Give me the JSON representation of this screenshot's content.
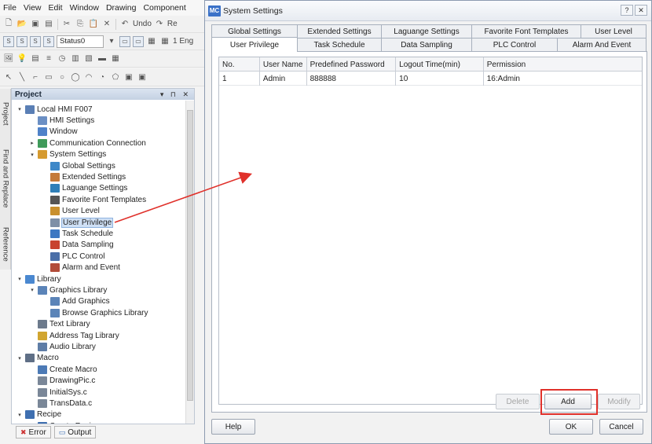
{
  "ide": {
    "menu": [
      "File",
      "View",
      "Edit",
      "Window",
      "Drawing",
      "Component"
    ],
    "toolbar1": {
      "undo_label": "Undo",
      "redo_label": "Re"
    },
    "toolbar2": {
      "status_combo": "Status0",
      "lang_label": "1 Eng"
    },
    "sidetabs": [
      "Project",
      "Find and Replace",
      "Reference"
    ],
    "project": {
      "title": "Project",
      "controls": "▾ ⊓ ✕",
      "tree": [
        {
          "label": "Local HMI F007",
          "level": 0,
          "exp": "▾",
          "icon": "monitor-icon",
          "color": "#5a7fb5"
        },
        {
          "label": "HMI Settings",
          "level": 1,
          "exp": "",
          "icon": "settings-icon",
          "color": "#6b8fc4"
        },
        {
          "label": "Window",
          "level": 1,
          "exp": "",
          "icon": "window-icon",
          "color": "#4f82c9"
        },
        {
          "label": "Communication Connection",
          "level": 1,
          "exp": "▸",
          "icon": "connection-icon",
          "color": "#3f9a5a"
        },
        {
          "label": "System Settings",
          "level": 1,
          "exp": "▾",
          "icon": "gear-icon",
          "color": "#d59a30"
        },
        {
          "label": "Global Settings",
          "level": 2,
          "exp": "",
          "icon": "globe-icon",
          "color": "#3e88c8"
        },
        {
          "label": "Extended Settings",
          "level": 2,
          "exp": "",
          "icon": "extend-icon",
          "color": "#c47a3a"
        },
        {
          "label": "Laguange Settings",
          "level": 2,
          "exp": "",
          "icon": "language-icon",
          "color": "#2f7fb8"
        },
        {
          "label": "Favorite Font Templates",
          "level": 2,
          "exp": "",
          "icon": "font-icon",
          "color": "#555555"
        },
        {
          "label": "User Level",
          "level": 2,
          "exp": "",
          "icon": "user-level-icon",
          "color": "#c9902e"
        },
        {
          "label": "User Privilege",
          "level": 2,
          "exp": "",
          "icon": "user-privilege-icon",
          "color": "#7e8fa6",
          "selected": true
        },
        {
          "label": "Task Schedule",
          "level": 2,
          "exp": "",
          "icon": "schedule-icon",
          "color": "#3d78c2"
        },
        {
          "label": "Data Sampling",
          "level": 2,
          "exp": "",
          "icon": "chart-icon",
          "color": "#c8432f"
        },
        {
          "label": "PLC Control",
          "level": 2,
          "exp": "",
          "icon": "plc-icon",
          "color": "#4a6fa8"
        },
        {
          "label": "Alarm and Event",
          "level": 2,
          "exp": "",
          "icon": "alarm-icon",
          "color": "#b24c3a"
        },
        {
          "label": "Library",
          "level": 0,
          "exp": "▾",
          "icon": "library-icon",
          "color": "#4a88d0"
        },
        {
          "label": "Graphics Library",
          "level": 1,
          "exp": "▾",
          "icon": "graphics-icon",
          "color": "#5b84b8"
        },
        {
          "label": "Add Graphics",
          "level": 2,
          "exp": "",
          "icon": "add-graphics-icon",
          "color": "#5b84b8"
        },
        {
          "label": "Browse Graphics Library",
          "level": 2,
          "exp": "",
          "icon": "browse-icon",
          "color": "#5b84b8"
        },
        {
          "label": "Text Library",
          "level": 1,
          "exp": "",
          "icon": "text-icon",
          "color": "#6c7a8c"
        },
        {
          "label": "Address Tag Library",
          "level": 1,
          "exp": "",
          "icon": "tag-icon",
          "color": "#d1a530"
        },
        {
          "label": "Audio Library",
          "level": 1,
          "exp": "",
          "icon": "audio-icon",
          "color": "#5f7da6"
        },
        {
          "label": "Macro",
          "level": 0,
          "exp": "▾",
          "icon": "macro-icon",
          "color": "#5f6f86"
        },
        {
          "label": "Create Macro",
          "level": 1,
          "exp": "",
          "icon": "create-macro-icon",
          "color": "#4c7ab6"
        },
        {
          "label": "DrawingPic.c",
          "level": 1,
          "exp": "",
          "icon": "c-file-icon",
          "color": "#7a8798"
        },
        {
          "label": "InitialSys.c",
          "level": 1,
          "exp": "",
          "icon": "c-file-icon",
          "color": "#7a8798"
        },
        {
          "label": "TransData.c",
          "level": 1,
          "exp": "",
          "icon": "c-file-icon",
          "color": "#7a8798"
        },
        {
          "label": "Recipe",
          "level": 0,
          "exp": "▾",
          "icon": "recipe-icon",
          "color": "#3f6fb0"
        },
        {
          "label": "Create Recipe",
          "level": 1,
          "exp": "",
          "icon": "create-recipe-icon",
          "color": "#3f6fb0"
        }
      ]
    },
    "bottom_tabs": [
      "Error",
      "Output"
    ]
  },
  "dialog": {
    "logo": "MC",
    "title": "System Settings",
    "help_glyph": "?",
    "close_glyph": "✕",
    "tabs_top": [
      "Global Settings",
      "Extended Settings",
      "Laguange Settings",
      "Favorite Font Templates",
      "User Level"
    ],
    "tabs_bottom": [
      "User Privilege",
      "Task Schedule",
      "Data Sampling",
      "PLC Control",
      "Alarm And Event"
    ],
    "active_tab": "User Privilege",
    "table": {
      "columns": [
        "No.",
        "User Name",
        "Predefined Password",
        "Logout Time(min)",
        "Permission"
      ],
      "rows": [
        [
          "1",
          "Admin",
          "888888",
          "10",
          "16:Admin"
        ]
      ]
    },
    "buttons": {
      "delete": "Delete",
      "add": "Add",
      "modify": "Modify",
      "help": "Help",
      "ok": "OK",
      "cancel": "Cancel"
    },
    "highlight_color": "#e0312b"
  }
}
